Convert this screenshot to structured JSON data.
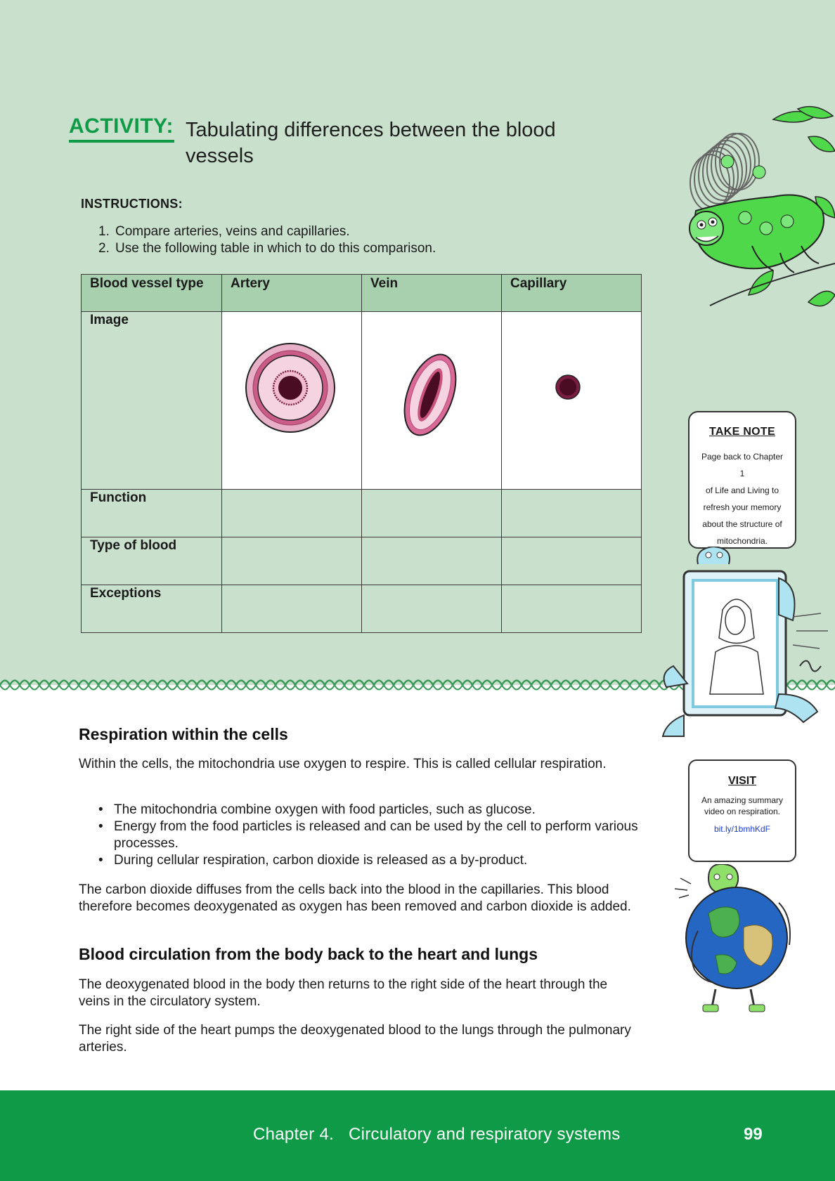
{
  "activity": {
    "label": "ACTIVITY:",
    "title": "Tabulating differences between the blood vessels"
  },
  "instructions": {
    "heading": "INSTRUCTIONS:",
    "items": [
      {
        "num": "1.",
        "text": "Compare arteries, veins and capillaries."
      },
      {
        "num": "2.",
        "text": "Use the following table in which to do this comparison."
      }
    ]
  },
  "table": {
    "headers": [
      "Blood vessel type",
      "Artery",
      "Vein",
      "Capillary"
    ],
    "rows": [
      "Image",
      "Function",
      "Type of blood",
      "Exceptions"
    ]
  },
  "take_note": {
    "title": "TAKE NOTE",
    "lines": [
      "Page back to Chapter 1",
      "of Life and Living to",
      "refresh your memory",
      "about the structure of",
      "mitochondria."
    ]
  },
  "visit": {
    "title": "VISIT",
    "text": "An amazing summary video on respiration.",
    "link": "bit.ly/1bmhKdF"
  },
  "section1": {
    "heading": "Respiration within the cells",
    "intro": "Within the cells, the mitochondria use oxygen to respire. This is called cellular respiration.",
    "bullets": [
      "The mitochondria combine oxygen with food particles, such as glucose.",
      "Energy from the food particles is released and can be used by the cell to perform various processes.",
      "During cellular respiration, carbon dioxide is released as a by-product."
    ],
    "outro": "The carbon dioxide diffuses from the cells back into the blood in the capillaries. This blood therefore becomes deoxygenated as oxygen has been removed and carbon dioxide is added."
  },
  "section2": {
    "heading": "Blood circulation from the body back to the heart and lungs",
    "p1": "The deoxygenated blood in the body then returns to the right side of the heart through the veins in the circulatory system.",
    "p2": "The right side of the heart pumps the deoxygenated blood to the lungs through the pulmonary arteries."
  },
  "footer": {
    "chapter": "Chapter 4.   Circulatory and respiratory systems",
    "page": "99"
  },
  "colors": {
    "band": "#c9e0cc",
    "accent_green": "#0e9a47",
    "table_header": "#a8cfae",
    "vessel_wall": "#f3c4d8",
    "vessel_lumen": "#5a0f2a"
  }
}
